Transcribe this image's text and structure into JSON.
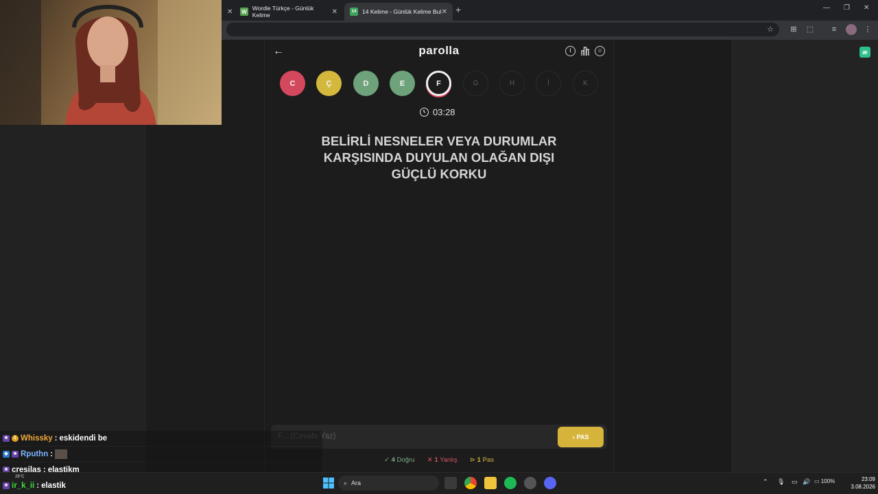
{
  "browser": {
    "tabs": [
      {
        "label": "Wordle Türkçe - Günlük Kelime",
        "favicon": "W",
        "color": "#5aa552"
      },
      {
        "label": "14 Kelime - Günlük Kelime Bul",
        "favicon": "14",
        "color": "#3fa35b"
      }
    ],
    "new_tab": "+"
  },
  "app": {
    "brand": "parolla",
    "letters": [
      {
        "letter": "C",
        "state": "wrong"
      },
      {
        "letter": "Ç",
        "state": "pass"
      },
      {
        "letter": "D",
        "state": "correct"
      },
      {
        "letter": "E",
        "state": "correct"
      },
      {
        "letter": "F",
        "state": "current"
      },
      {
        "letter": "G",
        "state": "empty"
      },
      {
        "letter": "H",
        "state": "empty"
      },
      {
        "letter": "İ",
        "state": "empty"
      },
      {
        "letter": "K",
        "state": "empty"
      }
    ],
    "timer": "03:28",
    "question_lines": [
      "BELİRLİ NESNELER VEYA DURUMLAR",
      "KARŞISINDA DUYULAN OLAĞAN DIŞI",
      "GÜÇLÜ KORKU"
    ],
    "answer_placeholder": "F... (Cevabı Yaz)",
    "pass_button": "PAS",
    "stats": {
      "correct_count": "4",
      "correct_label": "Doğru",
      "wrong_count": "1",
      "wrong_label": "Yanlış",
      "pass_count": "1",
      "pass_label": "Pas"
    }
  },
  "chat": [
    {
      "user": "Whissky",
      "message": "eskidendi be",
      "color": "#f0a93b"
    },
    {
      "user": "Rputhn",
      "message": "",
      "color": "#7ab3ff"
    },
    {
      "user": "cresilas",
      "message": "elastikm",
      "color": "#ffffff"
    },
    {
      "user": "ir_k_ii",
      "message": "elastik",
      "color": "#3be03b"
    }
  ],
  "taskbar": {
    "search": "Ara",
    "battery": "100%",
    "time": "23:09",
    "date": "3.08.2026",
    "weather": "26°C"
  },
  "colors": {
    "correct": "#6ea27b",
    "wrong": "#d3485d",
    "pass": "#d4b83e"
  }
}
